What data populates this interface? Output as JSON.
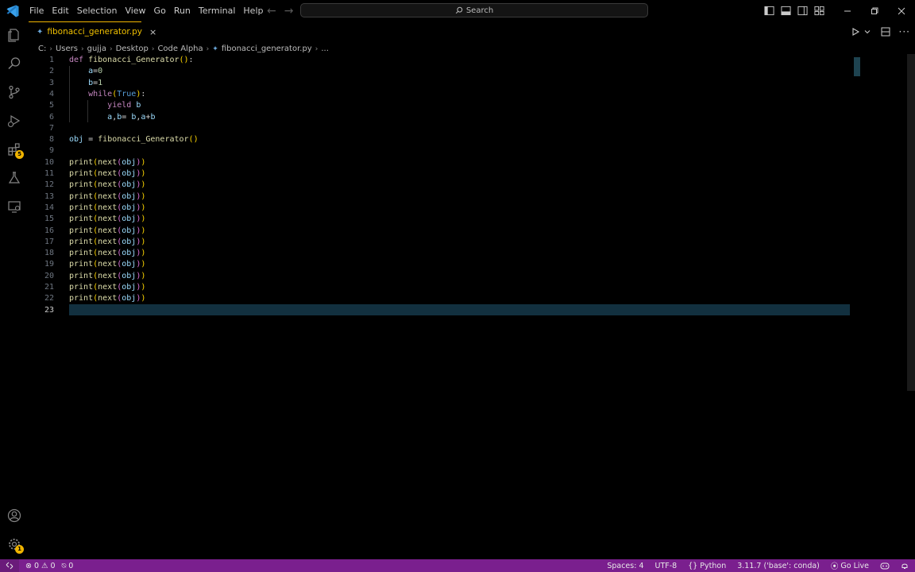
{
  "menu": [
    "File",
    "Edit",
    "Selection",
    "View",
    "Go",
    "Run",
    "Terminal",
    "Help"
  ],
  "search": {
    "label": "Search"
  },
  "tab": {
    "label": "fibonacci_generator.py",
    "close": "×"
  },
  "breadcrumb": [
    "C:",
    "Users",
    "gujja",
    "Desktop",
    "Code Alpha",
    "fibonacci_generator.py",
    "..."
  ],
  "badges": {
    "extensions": "5",
    "settings": "1"
  },
  "code_lines": [
    {
      "n": "1",
      "text": "def fibonacci_Generator():"
    },
    {
      "n": "2",
      "text": "    a=0"
    },
    {
      "n": "3",
      "text": "    b=1"
    },
    {
      "n": "4",
      "text": "    while(True):"
    },
    {
      "n": "5",
      "text": "        yield b"
    },
    {
      "n": "6",
      "text": "        a,b= b,a+b"
    },
    {
      "n": "7",
      "text": ""
    },
    {
      "n": "8",
      "text": "obj = fibonacci_Generator()"
    },
    {
      "n": "9",
      "text": ""
    },
    {
      "n": "10",
      "text": "print(next(obj))"
    },
    {
      "n": "11",
      "text": "print(next(obj))"
    },
    {
      "n": "12",
      "text": "print(next(obj))"
    },
    {
      "n": "13",
      "text": "print(next(obj))"
    },
    {
      "n": "14",
      "text": "print(next(obj))"
    },
    {
      "n": "15",
      "text": "print(next(obj))"
    },
    {
      "n": "16",
      "text": "print(next(obj))"
    },
    {
      "n": "17",
      "text": "print(next(obj))"
    },
    {
      "n": "18",
      "text": "print(next(obj))"
    },
    {
      "n": "19",
      "text": "print(next(obj))"
    },
    {
      "n": "20",
      "text": "print(next(obj))"
    },
    {
      "n": "21",
      "text": "print(next(obj))"
    },
    {
      "n": "22",
      "text": "print(next(obj))"
    },
    {
      "n": "23",
      "text": ""
    }
  ],
  "status": {
    "errors": "0",
    "warnings": "0",
    "ports": "0",
    "spaces": "Spaces: 4",
    "encoding": "UTF-8",
    "language": "Python",
    "interpreter": "3.11.7 ('base': conda)",
    "golive": "Go Live"
  },
  "colors": {
    "accent": "#f0b400",
    "statusbar": "#7a1f8e",
    "current_line": "#12303f"
  }
}
